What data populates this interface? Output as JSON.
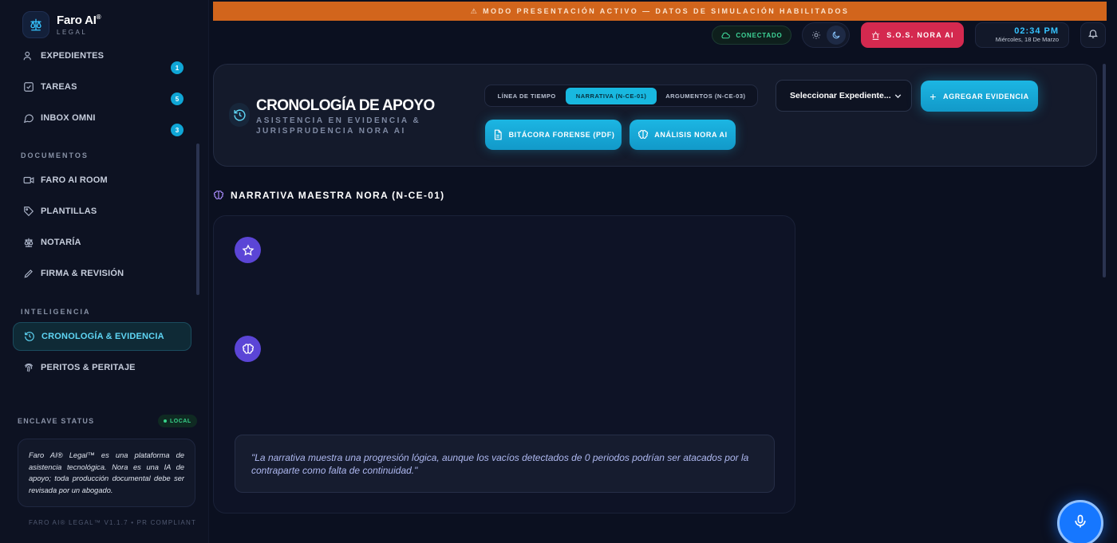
{
  "app": {
    "brand_name": "Faro AI",
    "brand_sup": "®",
    "brand_sub": "LEGAL"
  },
  "sidebar": {
    "items": [
      {
        "label": "EXPEDIENTES",
        "icon": "users-icon"
      },
      {
        "label": "TAREAS",
        "icon": "check-square-icon"
      },
      {
        "label": "INBOX OMNI",
        "icon": "chat-icon"
      },
      {
        "label": "FARO AI ROOM",
        "icon": "video-icon"
      },
      {
        "label": "PLANTILLAS",
        "icon": "tag-icon"
      },
      {
        "label": "NOTARÍA",
        "icon": "scale-icon"
      },
      {
        "label": "FIRMA & REVISIÓN",
        "icon": "pen-icon"
      },
      {
        "label": "CRONOLOGÍA & EVIDENCIA",
        "icon": "history-icon"
      },
      {
        "label": "PERITOS & PERITAJE",
        "icon": "fingerprint-icon"
      }
    ],
    "badges": [
      "1",
      "5",
      "3"
    ],
    "sections": {
      "documentos": "DOCUMENTOS",
      "inteligencia": "INTELIGENCIA"
    },
    "enclave_label": "ENCLAVE STATUS",
    "enclave_status": "LOCAL",
    "disclaimer": "Faro AI® Legal™ es una plataforma de asistencia tecnológica. Nora es una IA de apoyo; toda producción documental debe ser revisada por un abogado.",
    "version": "FARO AI® LEGAL™ V1.1.7 • PR COMPLIANT"
  },
  "banner": "⚠ MODO PRESENTACIÓN ACTIVO — DATOS DE SIMULACIÓN HABILITADOS",
  "topbar": {
    "connection": "CONECTADO",
    "sos": "S.O.S. NORA AI",
    "time": "02:34 PM",
    "date": "Miércoles, 18 De Marzo"
  },
  "header": {
    "title": "CRONOLOGÍA DE APOYO",
    "subtitle": "ASISTENCIA EN EVIDENCIA & JURISPRUDENCIA NORA AI",
    "tabs": [
      {
        "label": "LÍNEA DE TIEMPO",
        "active": false
      },
      {
        "label": "NARRATIVA (N-CE-01)",
        "active": true
      },
      {
        "label": "ARGUMENTOS (N-CE-03)",
        "active": false
      }
    ],
    "btn_bitacora": "BITÁCORA FORENSE (PDF)",
    "btn_analisis": "ANÁLISIS NORA AI",
    "select_value": "Seleccionar Expediente...",
    "add_label": "AGREGAR EVIDENCIA"
  },
  "narrative": {
    "heading": "NARRATIVA MAESTRA NORA (N-CE-01)",
    "quote": "\"La narrativa muestra una progresión lógica, aunque los vacíos detectados de 0 periodos podrían ser atacados por la contraparte como falta de continuidad.\""
  },
  "colors": {
    "accent": "#1cb6e3",
    "banner": "#d2651c",
    "sos": "#d4294f",
    "success": "#3ed598",
    "violet": "#5b45d6"
  }
}
